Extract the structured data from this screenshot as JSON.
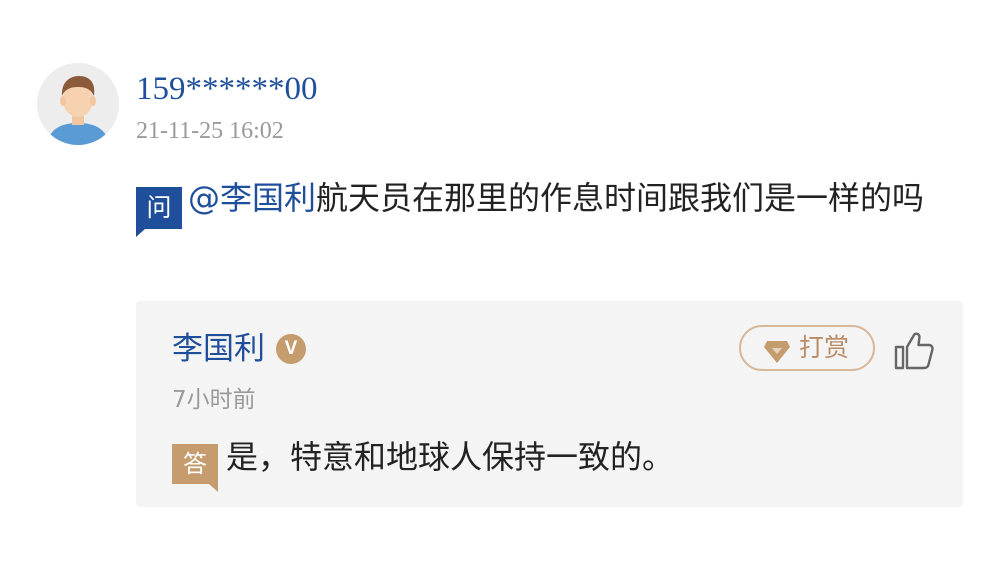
{
  "comment": {
    "avatar_icon": "user-avatar-icon",
    "username": "159******00",
    "time": "21-11-25 16:02",
    "question_badge": "问",
    "mention": "@李国利",
    "question_text": "航天员在那里的作息时间跟我们是一样的吗"
  },
  "answer": {
    "name": "李国利",
    "verified_mark": "V",
    "tip_label": "打赏",
    "tip_icon": "diamond-icon",
    "like_icon": "thumbs-up-icon",
    "time": "7小时前",
    "answer_badge": "答",
    "text": "是，特意和地球人保持一致的。"
  },
  "colors": {
    "link_blue": "#1f4f9b",
    "gold": "#c59c6d",
    "card_bg": "#f4f4f4",
    "muted_text": "#9a9a9a"
  }
}
